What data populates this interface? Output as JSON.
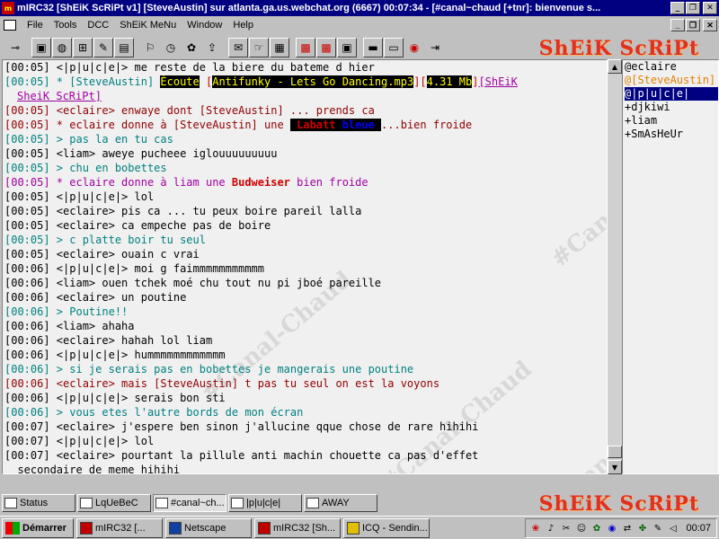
{
  "window": {
    "title": "mIRC32 [ShEiK ScRiPt v1] [SteveAustin] sur atlanta.ga.us.webchat.org (6667) 00:07:34 - [#canal~chaud [+tnr]:  bienvenue s..."
  },
  "menu": {
    "items": [
      "File",
      "Tools",
      "DCC",
      "ShEiK MeNu",
      "Window",
      "Help"
    ]
  },
  "branding": {
    "logo_top": "ShEiK ScRiPt",
    "logo_bottom": "ShEiK ScRiPt",
    "watermark": "#Canal-Chaud",
    "accent": "#e03020"
  },
  "colors": {
    "title_bar": "#000080",
    "chat_bg": "#f0f0f0",
    "green_text": "#008080",
    "red_text": "#900000",
    "purple_text": "#a000a0"
  },
  "chat": {
    "lines": [
      {
        "ts": "[00:05]",
        "text": " <|p|u|c|e|> me reste de la biere du bateme d hier",
        "color": "black"
      },
      {
        "ts": "[00:05]",
        "text": " * [SteveAustin] ",
        "color": "green",
        "extra": "now_playing"
      },
      {
        "ts": "",
        "text": "SheiK ScRiPt]",
        "color": "purple",
        "cont": true
      },
      {
        "ts": "[00:05]",
        "text": " <eclaire> enwaye dont [SteveAustin] ... prends ca",
        "color": "red"
      },
      {
        "ts": "[00:05]",
        "text": " * eclaire donne à [SteveAustin] une ",
        "color": "red",
        "extra": "labatt"
      },
      {
        "ts": "[00:05]",
        "text": " > pas la en tu cas",
        "color": "green"
      },
      {
        "ts": "[00:05]",
        "text": " <liam> aweye pucheee iglouuuuuuuuu",
        "color": "black"
      },
      {
        "ts": "[00:05]",
        "text": " > chu en bobettes",
        "color": "green"
      },
      {
        "ts": "[00:05]",
        "text": " * eclaire donne à liam une ",
        "color": "purple",
        "extra": "budweiser"
      },
      {
        "ts": "[00:05]",
        "text": " <|p|u|c|e|> lol",
        "color": "black"
      },
      {
        "ts": "[00:05]",
        "text": " <eclaire> pis ca ... tu peux boire pareil lalla",
        "color": "black"
      },
      {
        "ts": "[00:05]",
        "text": " <eclaire> ca empeche pas de boire",
        "color": "black"
      },
      {
        "ts": "[00:05]",
        "text": " > c platte boir tu seul",
        "color": "green"
      },
      {
        "ts": "[00:05]",
        "text": " <eclaire> ouain c vrai",
        "color": "black"
      },
      {
        "ts": "[00:06]",
        "text": " <|p|u|c|e|> moi g faimmmmmmmmmmm",
        "color": "black"
      },
      {
        "ts": "[00:06]",
        "text": " <liam> ouen tchek moé chu tout nu pi jboé pareille",
        "color": "black"
      },
      {
        "ts": "[00:06]",
        "text": " <eclaire> un poutine",
        "color": "black"
      },
      {
        "ts": "[00:06]",
        "text": " > Poutine!!",
        "color": "green"
      },
      {
        "ts": "[00:06]",
        "text": " <liam> ahaha",
        "color": "black"
      },
      {
        "ts": "[00:06]",
        "text": " <eclaire> hahah lol liam",
        "color": "black"
      },
      {
        "ts": "[00:06]",
        "text": " <|p|u|c|e|> hummmmmmmmmmmm",
        "color": "black"
      },
      {
        "ts": "[00:06]",
        "text": " > si je serais pas en bobettes je mangerais une poutine",
        "color": "green"
      },
      {
        "ts": "[00:06]",
        "text": " <eclaire> mais [SteveAustin] t pas tu seul on est la voyons",
        "color": "red"
      },
      {
        "ts": "[00:06]",
        "text": " <|p|u|c|e|> serais bon sti",
        "color": "black"
      },
      {
        "ts": "[00:06]",
        "text": " > vous etes l'autre bords de mon écran",
        "color": "green"
      },
      {
        "ts": "[00:07]",
        "text": " <eclaire> j'espere ben sinon j'allucine qque chose de rare hihihi",
        "color": "black"
      },
      {
        "ts": "[00:07]",
        "text": " <|p|u|c|e|> lol",
        "color": "black"
      },
      {
        "ts": "[00:07]",
        "text": " <eclaire> pourtant la pillule anti machin chouette ca pas d'effet",
        "color": "black"
      },
      {
        "ts": "",
        "text": "  secondaire de meme hihihi",
        "color": "black",
        "cont": true
      }
    ],
    "now_playing": {
      "label": "Écoute",
      "track": "Antifunky - Lets Go Dancing.mp3",
      "size": "4.31 Mb",
      "script": "ShEiK"
    },
    "labatt": {
      "brand": "Labatt",
      "type": "bleue",
      "suffix": "...bien froide"
    },
    "budweiser": {
      "brand": "Budweiser",
      "suffix": " bien froide"
    }
  },
  "nicklist": [
    {
      "nick": "@eclaire",
      "style": "normal"
    },
    {
      "nick": "@[SteveAustin]",
      "style": "op-orange"
    },
    {
      "nick": "@|p|u|c|e|",
      "style": "selected"
    },
    {
      "nick": "+djkiwi",
      "style": "normal"
    },
    {
      "nick": "+liam",
      "style": "normal"
    },
    {
      "nick": "+SmAsHeUr",
      "style": "normal"
    }
  ],
  "switchbar": [
    {
      "label": "Status",
      "active": false
    },
    {
      "label": "LqUeBeC",
      "active": false
    },
    {
      "label": "#canal~ch...",
      "active": true
    },
    {
      "label": "|p|u|c|e|",
      "active": false
    },
    {
      "label": "AWAY",
      "active": false
    }
  ],
  "taskbar": {
    "start_label": "Démarrer",
    "tasks": [
      "mIRC32 [...",
      "Netscape",
      "mIRC32 [Sh...",
      "ICQ - Sendin..."
    ],
    "clock": "00:07"
  }
}
